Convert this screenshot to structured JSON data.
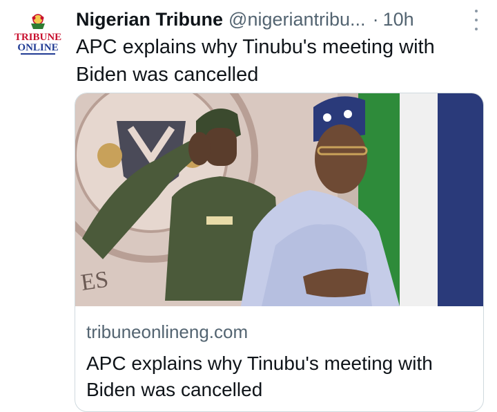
{
  "tweet": {
    "author_name": "Nigerian Tribune",
    "handle": "@nigeriantribu...",
    "separator": "·",
    "time": "10h",
    "text": "APC explains why Tinubu's meeting with Biden was cancelled",
    "avatar": {
      "icon": "tribune-online-logo",
      "line1": "TRIBUNE",
      "line2": "ONLINE"
    }
  },
  "card": {
    "domain": "tribuneonlineng.com",
    "title": "APC explains why Tinubu's meeting with Biden was cancelled",
    "image_text": "ES"
  },
  "colors": {
    "text": "#0f1419",
    "muted": "#536471",
    "border": "#cfd9de",
    "logo_red": "#c8102e",
    "logo_navy": "#1f3a93"
  }
}
